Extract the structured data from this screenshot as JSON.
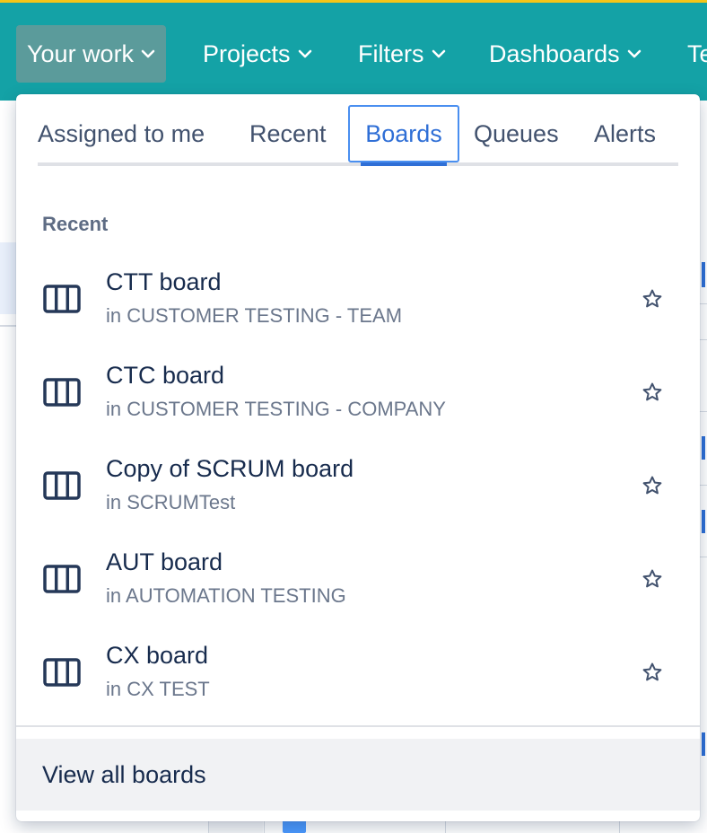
{
  "nav": {
    "items": [
      {
        "label": "Your work",
        "active": true
      },
      {
        "label": "Projects",
        "active": false
      },
      {
        "label": "Filters",
        "active": false
      },
      {
        "label": "Dashboards",
        "active": false
      },
      {
        "label": "Te",
        "active": false
      }
    ]
  },
  "dropdown": {
    "tabs": [
      {
        "label": "Assigned to me",
        "selected": false
      },
      {
        "label": "Recent",
        "selected": false
      },
      {
        "label": "Boards",
        "selected": true
      },
      {
        "label": "Queues",
        "selected": false
      },
      {
        "label": "Alerts",
        "selected": false
      }
    ],
    "section_heading": "Recent",
    "boards": [
      {
        "title": "CTT board",
        "subtitle": "in CUSTOMER TESTING - TEAM",
        "icon": "board-icon",
        "action_icon": "star-icon"
      },
      {
        "title": "CTC board",
        "subtitle": "in CUSTOMER TESTING - COMPANY",
        "icon": "board-icon",
        "action_icon": "star-icon"
      },
      {
        "title": "Copy of SCRUM board",
        "subtitle": "in SCRUMTest",
        "icon": "board-icon",
        "action_icon": "star-icon"
      },
      {
        "title": "AUT board",
        "subtitle": "in AUTOMATION TESTING",
        "icon": "board-icon",
        "action_icon": "star-icon"
      },
      {
        "title": "CX board",
        "subtitle": "in CX TEST",
        "icon": "board-icon",
        "action_icon": "star-icon"
      }
    ],
    "footer_label": "View all boards"
  },
  "colors": {
    "topbar": "#14a2a6",
    "topbar_accent": "#f5c518",
    "active_nav": "#5b9b9b",
    "selected_tab": "#2f6fd6",
    "board_icon": "#253858"
  }
}
